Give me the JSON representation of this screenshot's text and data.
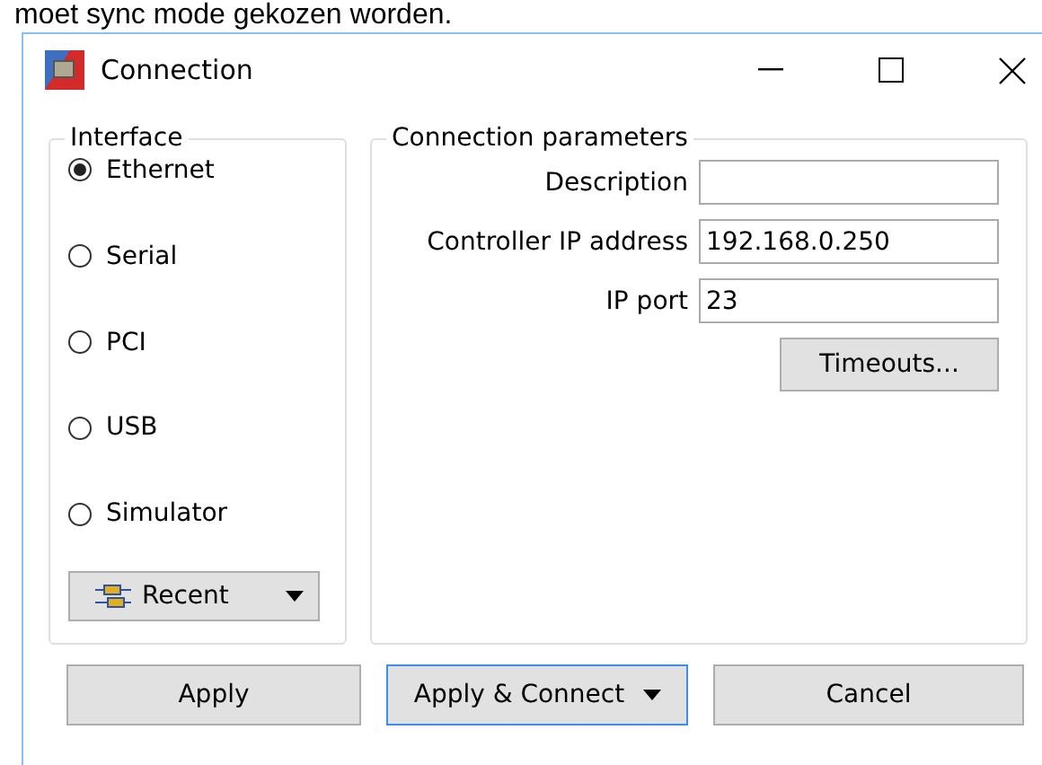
{
  "background_text": "moet sync mode gekozen worden.",
  "window": {
    "title": "Connection"
  },
  "interface": {
    "title": "Interface",
    "options": [
      {
        "label": "Ethernet",
        "selected": true
      },
      {
        "label": "Serial",
        "selected": false
      },
      {
        "label": "PCI",
        "selected": false
      },
      {
        "label": "USB",
        "selected": false
      },
      {
        "label": "Simulator",
        "selected": false
      }
    ],
    "recent_button": "Recent"
  },
  "parameters": {
    "title": "Connection parameters",
    "fields": [
      {
        "label": "Description"
      },
      {
        "label": "Controller IP address",
        "value": "192.168.0.250"
      },
      {
        "label": "IP port",
        "value": "23"
      }
    ],
    "timeouts_button": "Timeouts..."
  },
  "buttons": [
    {
      "label": "Apply",
      "focused": false,
      "dropdown": false
    },
    {
      "label": "Apply & Connect",
      "focused": true,
      "dropdown": true
    },
    {
      "label": "Cancel",
      "focused": false,
      "dropdown": false
    }
  ]
}
